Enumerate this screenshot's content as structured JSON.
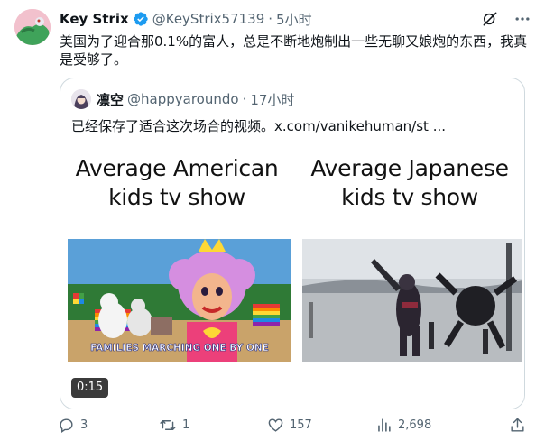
{
  "author": {
    "name": "Key Strix",
    "handle": "@KeyStrix57139",
    "separator": "·",
    "time": "5小时"
  },
  "tweet": {
    "text": "美国为了迎合那0.1%的富人，总是不断地炮制出一些无聊又娘炮的东西，我真是受够了。"
  },
  "quote": {
    "author_name": "凛空",
    "handle": "@happyaroundo",
    "separator": "·",
    "time": "17小时",
    "text": "已经保存了适合这次场合的视频。x.com/vanikehuman/st ..."
  },
  "media": {
    "left_caption_line1": "Average American",
    "left_caption_line2": "kids tv show",
    "right_caption_line1": "Average Japanese",
    "right_caption_line2": "kids tv show",
    "left_frame_caption": "FAMILIES MARCHING ONE BY ONE",
    "duration": "0:15"
  },
  "actions": {
    "replies": "3",
    "retweets": "1",
    "likes": "157",
    "views": "2,698"
  },
  "colors": {
    "text": "#0f1419",
    "secondary": "#536471",
    "verified": "#1d9bf0",
    "border": "#cfd9de"
  }
}
